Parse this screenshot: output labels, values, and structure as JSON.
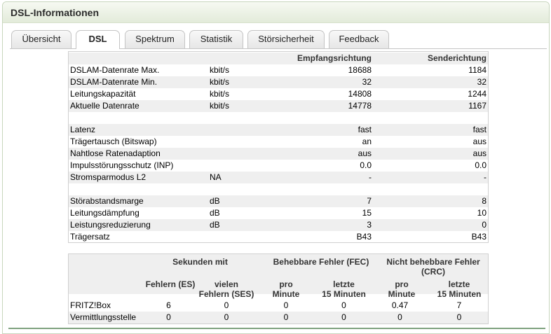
{
  "title": "DSL-Informationen",
  "tabs": [
    {
      "label": "Übersicht"
    },
    {
      "label": "DSL"
    },
    {
      "label": "Spektrum"
    },
    {
      "label": "Statistik"
    },
    {
      "label": "Störsicherheit"
    },
    {
      "label": "Feedback"
    }
  ],
  "active_tab": "DSL",
  "line_table": {
    "headers": {
      "rx": "Empfangsrichtung",
      "tx": "Senderichtung"
    },
    "rows": [
      {
        "label": "DSLAM-Datenrate Max.",
        "unit": "kbit/s",
        "rx": "18688",
        "tx": "1184"
      },
      {
        "label": "DSLAM-Datenrate Min.",
        "unit": "kbit/s",
        "rx": "32",
        "tx": "32"
      },
      {
        "label": "Leitungskapazität",
        "unit": "kbit/s",
        "rx": "14808",
        "tx": "1244"
      },
      {
        "label": "Aktuelle Datenrate",
        "unit": "kbit/s",
        "rx": "14778",
        "tx": "1167"
      },
      {
        "label": "",
        "unit": "",
        "rx": "",
        "tx": ""
      },
      {
        "label": "Latenz",
        "unit": "",
        "rx": "fast",
        "tx": "fast"
      },
      {
        "label": "Trägertausch (Bitswap)",
        "unit": "",
        "rx": "an",
        "tx": "aus"
      },
      {
        "label": "Nahtlose Ratenadaption",
        "unit": "",
        "rx": "aus",
        "tx": "aus"
      },
      {
        "label": "Impulsstörungsschutz (INP)",
        "unit": "",
        "rx": "0.0",
        "tx": "0.0"
      },
      {
        "label": "Stromsparmodus L2",
        "unit": "NA",
        "rx": "-",
        "tx": "-"
      },
      {
        "label": "",
        "unit": "",
        "rx": "",
        "tx": ""
      },
      {
        "label": "Störabstandsmarge",
        "unit": "dB",
        "rx": "7",
        "tx": "8"
      },
      {
        "label": "Leitungsdämpfung",
        "unit": "dB",
        "rx": "15",
        "tx": "10"
      },
      {
        "label": "Leistungsreduzierung",
        "unit": "dB",
        "rx": "3",
        "tx": "0"
      },
      {
        "label": "Trägersatz",
        "unit": "",
        "rx": "B43",
        "tx": "B43"
      }
    ]
  },
  "error_table": {
    "group_headers": {
      "seconds": "Sekunden mit",
      "fec": "Behebbare Fehler (FEC)",
      "crc_line1": "Nicht behebbare Fehler",
      "crc_line2": "(CRC)"
    },
    "sub_headers": {
      "es_line1": "Fehlern (ES)",
      "ses_line1": "vielen",
      "ses_line2": "Fehlern (SES)",
      "fec_min_line1": "pro",
      "fec_min_line2": "Minute",
      "fec_15_line1": "letzte",
      "fec_15_line2": "15 Minuten",
      "crc_min_line1": "pro",
      "crc_min_line2": "Minute",
      "crc_15_line1": "letzte",
      "crc_15_line2": "15 Minuten"
    },
    "rows": [
      {
        "label": "FRITZ!Box",
        "es": "6",
        "ses": "0",
        "fec_min": "0",
        "fec_15": "0",
        "crc_min": "0.47",
        "crc_15": "7"
      },
      {
        "label": "Vermittlungsstelle",
        "es": "0",
        "ses": "0",
        "fec_min": "0",
        "fec_15": "0",
        "crc_min": "0",
        "crc_15": "0"
      }
    ]
  }
}
